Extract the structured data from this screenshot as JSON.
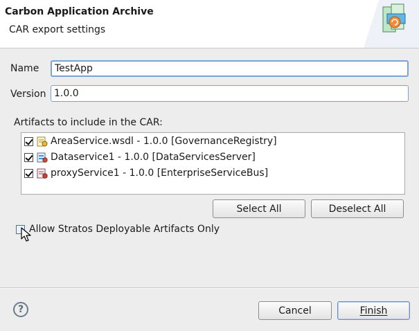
{
  "banner": {
    "title": "Carbon Application Archive",
    "subtitle": "CAR export settings",
    "graphic_icon": "carbon-archive-wizard-icon"
  },
  "form": {
    "name_label": "Name",
    "name_value": "TestApp",
    "version_label": "Version",
    "version_value": "1.0.0"
  },
  "artifacts": {
    "heading": "Artifacts to include in the CAR:",
    "items": [
      {
        "label": "AreaService.wsdl - 1.0.0 [GovernanceRegistry]",
        "checked": true,
        "icon": "registry-resource-icon"
      },
      {
        "label": "Dataservice1 - 1.0.0 [DataServicesServer]",
        "checked": true,
        "icon": "data-service-icon"
      },
      {
        "label": "proxyService1 - 1.0.0 [EnterpriseServiceBus]",
        "checked": true,
        "icon": "proxy-service-icon"
      }
    ],
    "select_all_label": "Select All",
    "deselect_all_label": "Deselect All"
  },
  "stratos": {
    "label": "Allow Stratos Deployable Artifacts Only",
    "checked": false
  },
  "footer": {
    "help_glyph": "?",
    "cancel_label": "Cancel",
    "finish_label": "Finish"
  }
}
